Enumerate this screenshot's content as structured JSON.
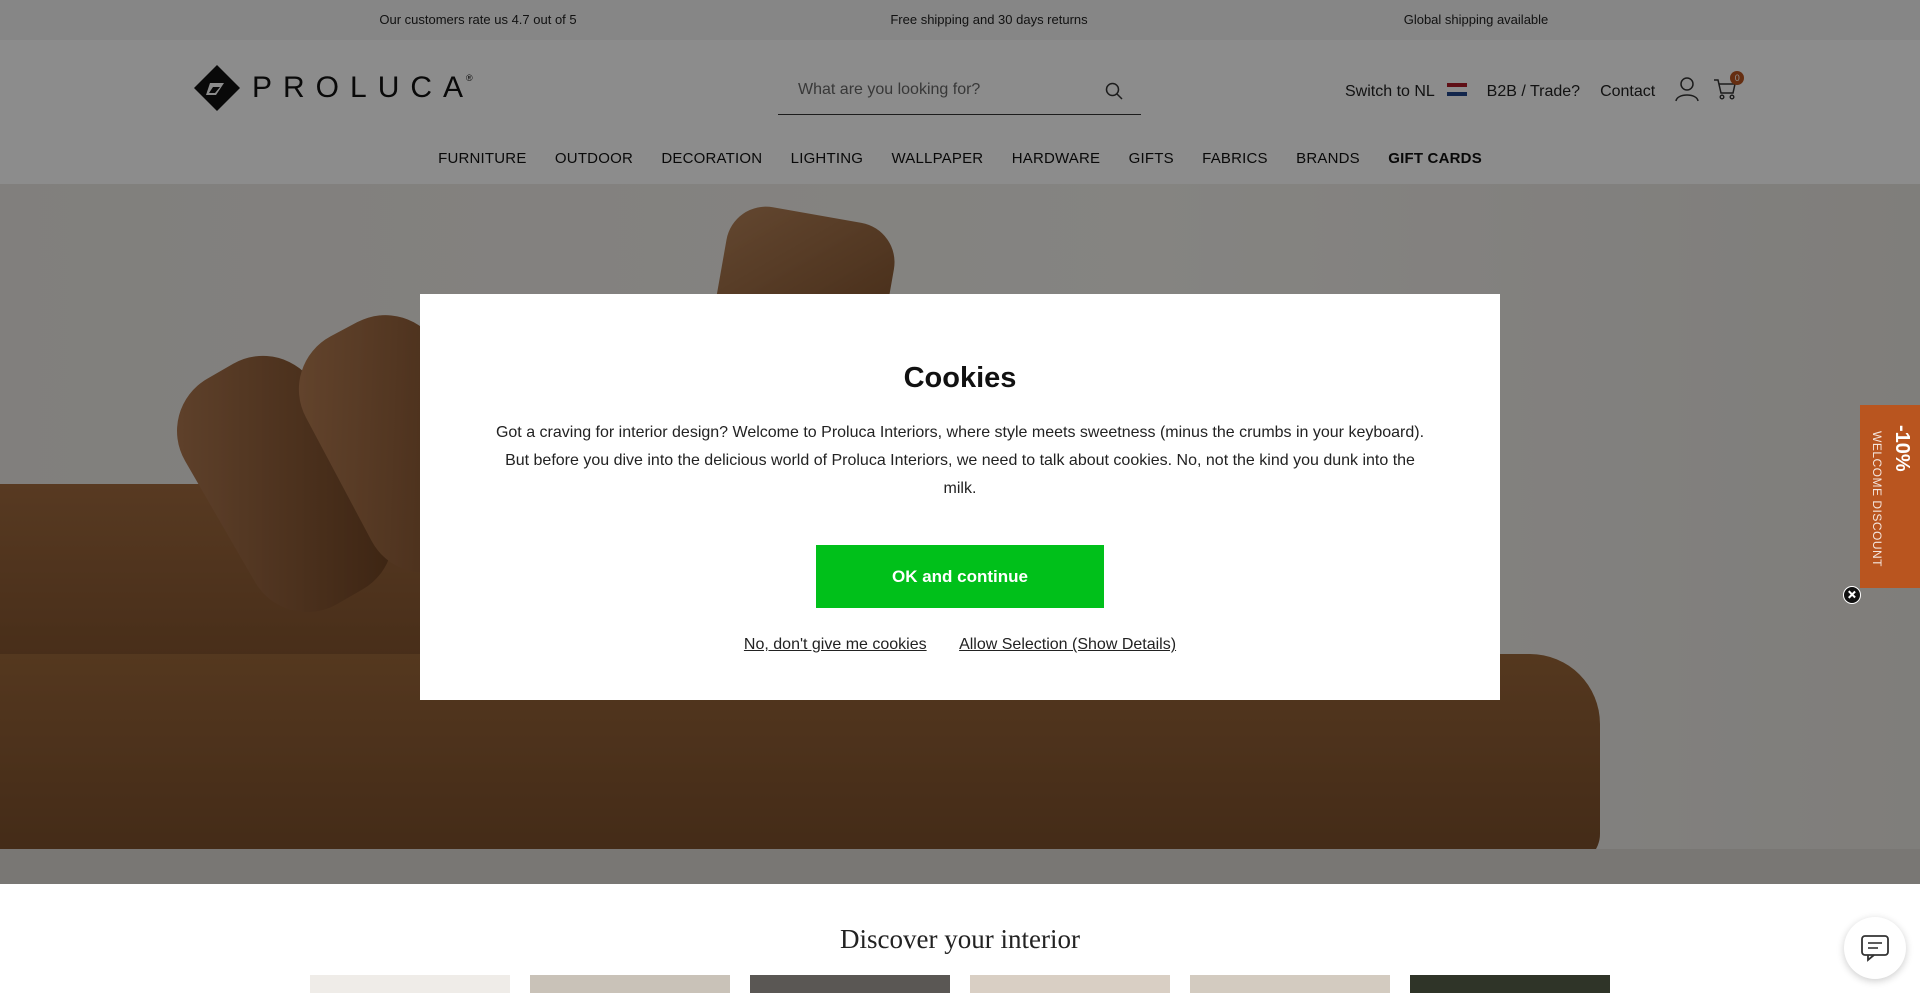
{
  "topbar": {
    "rating": "Our customers rate us 4.7 out of 5",
    "shipping": "Free shipping and 30 days returns",
    "global": "Global shipping available"
  },
  "header": {
    "logo_text": "PROLUCA",
    "logo_mark": "®",
    "search_placeholder": "What are you looking for?",
    "switch_label": "Switch to NL",
    "b2b_label": "B2B / Trade?",
    "contact_label": "Contact",
    "cart_count": "0",
    "icons": [
      "search-icon",
      "user-icon",
      "cart-icon",
      "nl-flag-icon"
    ]
  },
  "nav": {
    "items": [
      "FURNITURE",
      "OUTDOOR",
      "DECORATION",
      "LIGHTING",
      "WALLPAPER",
      "HARDWARE",
      "GIFTS",
      "FABRICS",
      "BRANDS",
      "GIFT CARDS"
    ]
  },
  "discount": {
    "percent": "-10%",
    "label": "WELCOME DISCOUNT"
  },
  "cookies": {
    "title": "Cookies",
    "body": "Got a craving for interior design? Welcome to Proluca Interiors, where style meets sweetness (minus the crumbs in your keyboard). But before you dive into the delicious world of Proluca Interiors, we need to talk about cookies. No, not the kind you dunk into the milk.",
    "ok_label": "OK and continue",
    "decline_label": "No, don't give me cookies",
    "selection_label": "Allow Selection (Show Details)"
  },
  "discover": {
    "title": "Discover your interior"
  },
  "colors": {
    "accent": "#b9551f",
    "ok_button": "#00c01a"
  }
}
